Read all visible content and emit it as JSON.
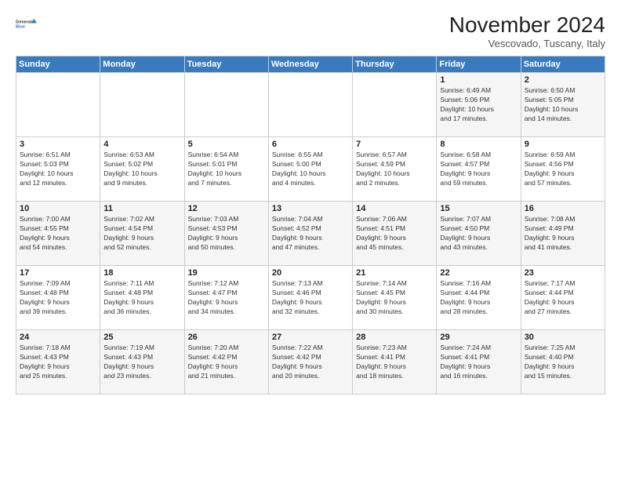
{
  "logo": {
    "line1": "General",
    "line2": "Blue"
  },
  "title": "November 2024",
  "subtitle": "Vescovado, Tuscany, Italy",
  "headers": [
    "Sunday",
    "Monday",
    "Tuesday",
    "Wednesday",
    "Thursday",
    "Friday",
    "Saturday"
  ],
  "weeks": [
    [
      {
        "day": "",
        "info": ""
      },
      {
        "day": "",
        "info": ""
      },
      {
        "day": "",
        "info": ""
      },
      {
        "day": "",
        "info": ""
      },
      {
        "day": "",
        "info": ""
      },
      {
        "day": "1",
        "info": "Sunrise: 6:49 AM\nSunset: 5:06 PM\nDaylight: 10 hours\nand 17 minutes."
      },
      {
        "day": "2",
        "info": "Sunrise: 6:50 AM\nSunset: 5:05 PM\nDaylight: 10 hours\nand 14 minutes."
      }
    ],
    [
      {
        "day": "3",
        "info": "Sunrise: 6:51 AM\nSunset: 5:03 PM\nDaylight: 10 hours\nand 12 minutes."
      },
      {
        "day": "4",
        "info": "Sunrise: 6:53 AM\nSunset: 5:02 PM\nDaylight: 10 hours\nand 9 minutes."
      },
      {
        "day": "5",
        "info": "Sunrise: 6:54 AM\nSunset: 5:01 PM\nDaylight: 10 hours\nand 7 minutes."
      },
      {
        "day": "6",
        "info": "Sunrise: 6:55 AM\nSunset: 5:00 PM\nDaylight: 10 hours\nand 4 minutes."
      },
      {
        "day": "7",
        "info": "Sunrise: 6:57 AM\nSunset: 4:59 PM\nDaylight: 10 hours\nand 2 minutes."
      },
      {
        "day": "8",
        "info": "Sunrise: 6:58 AM\nSunset: 4:57 PM\nDaylight: 9 hours\nand 59 minutes."
      },
      {
        "day": "9",
        "info": "Sunrise: 6:59 AM\nSunset: 4:56 PM\nDaylight: 9 hours\nand 57 minutes."
      }
    ],
    [
      {
        "day": "10",
        "info": "Sunrise: 7:00 AM\nSunset: 4:55 PM\nDaylight: 9 hours\nand 54 minutes."
      },
      {
        "day": "11",
        "info": "Sunrise: 7:02 AM\nSunset: 4:54 PM\nDaylight: 9 hours\nand 52 minutes."
      },
      {
        "day": "12",
        "info": "Sunrise: 7:03 AM\nSunset: 4:53 PM\nDaylight: 9 hours\nand 50 minutes."
      },
      {
        "day": "13",
        "info": "Sunrise: 7:04 AM\nSunset: 4:52 PM\nDaylight: 9 hours\nand 47 minutes."
      },
      {
        "day": "14",
        "info": "Sunrise: 7:06 AM\nSunset: 4:51 PM\nDaylight: 9 hours\nand 45 minutes."
      },
      {
        "day": "15",
        "info": "Sunrise: 7:07 AM\nSunset: 4:50 PM\nDaylight: 9 hours\nand 43 minutes."
      },
      {
        "day": "16",
        "info": "Sunrise: 7:08 AM\nSunset: 4:49 PM\nDaylight: 9 hours\nand 41 minutes."
      }
    ],
    [
      {
        "day": "17",
        "info": "Sunrise: 7:09 AM\nSunset: 4:48 PM\nDaylight: 9 hours\nand 39 minutes."
      },
      {
        "day": "18",
        "info": "Sunrise: 7:11 AM\nSunset: 4:48 PM\nDaylight: 9 hours\nand 36 minutes."
      },
      {
        "day": "19",
        "info": "Sunrise: 7:12 AM\nSunset: 4:47 PM\nDaylight: 9 hours\nand 34 minutes."
      },
      {
        "day": "20",
        "info": "Sunrise: 7:13 AM\nSunset: 4:46 PM\nDaylight: 9 hours\nand 32 minutes."
      },
      {
        "day": "21",
        "info": "Sunrise: 7:14 AM\nSunset: 4:45 PM\nDaylight: 9 hours\nand 30 minutes."
      },
      {
        "day": "22",
        "info": "Sunrise: 7:16 AM\nSunset: 4:44 PM\nDaylight: 9 hours\nand 28 minutes."
      },
      {
        "day": "23",
        "info": "Sunrise: 7:17 AM\nSunset: 4:44 PM\nDaylight: 9 hours\nand 27 minutes."
      }
    ],
    [
      {
        "day": "24",
        "info": "Sunrise: 7:18 AM\nSunset: 4:43 PM\nDaylight: 9 hours\nand 25 minutes."
      },
      {
        "day": "25",
        "info": "Sunrise: 7:19 AM\nSunset: 4:43 PM\nDaylight: 9 hours\nand 23 minutes."
      },
      {
        "day": "26",
        "info": "Sunrise: 7:20 AM\nSunset: 4:42 PM\nDaylight: 9 hours\nand 21 minutes."
      },
      {
        "day": "27",
        "info": "Sunrise: 7:22 AM\nSunset: 4:42 PM\nDaylight: 9 hours\nand 20 minutes."
      },
      {
        "day": "28",
        "info": "Sunrise: 7:23 AM\nSunset: 4:41 PM\nDaylight: 9 hours\nand 18 minutes."
      },
      {
        "day": "29",
        "info": "Sunrise: 7:24 AM\nSunset: 4:41 PM\nDaylight: 9 hours\nand 16 minutes."
      },
      {
        "day": "30",
        "info": "Sunrise: 7:25 AM\nSunset: 4:40 PM\nDaylight: 9 hours\nand 15 minutes."
      }
    ]
  ]
}
